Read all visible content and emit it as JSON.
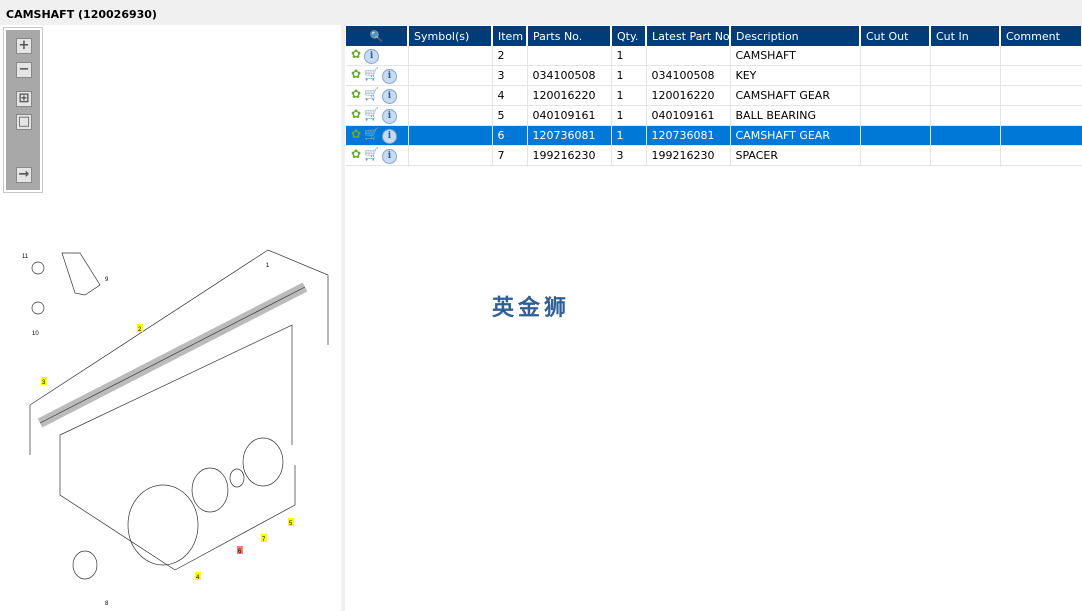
{
  "title": "CAMSHAFT (120026930)",
  "toolbar": {
    "zoom_in": "+",
    "zoom_out": "−"
  },
  "columns": [
    "Symbol(s)",
    "Item",
    "Parts No.",
    "Qty.",
    "Latest Part No.",
    "Description",
    "Cut Out",
    "Cut In",
    "Comment"
  ],
  "rows": [
    {
      "item": "2",
      "parts_no": "",
      "qty": "1",
      "latest": "",
      "description": "CAMSHAFT",
      "cart": false,
      "selected": false
    },
    {
      "item": "3",
      "parts_no": "034100508",
      "qty": "1",
      "latest": "034100508",
      "description": "KEY",
      "cart": true,
      "selected": false
    },
    {
      "item": "4",
      "parts_no": "120016220",
      "qty": "1",
      "latest": "120016220",
      "description": "CAMSHAFT GEAR",
      "cart": true,
      "selected": false
    },
    {
      "item": "5",
      "parts_no": "040109161",
      "qty": "1",
      "latest": "040109161",
      "description": "BALL BEARING",
      "cart": true,
      "selected": false
    },
    {
      "item": "6",
      "parts_no": "120736081",
      "qty": "1",
      "latest": "120736081",
      "description": "CAMSHAFT GEAR",
      "cart": true,
      "selected": true
    },
    {
      "item": "7",
      "parts_no": "199216230",
      "qty": "3",
      "latest": "199216230",
      "description": "SPACER",
      "cart": true,
      "selected": false
    }
  ],
  "watermark": "英金狮",
  "diagram_labels": [
    "1",
    "2",
    "3",
    "4",
    "5",
    "6",
    "7",
    "8",
    "9",
    "10",
    "11"
  ],
  "colors": {
    "header": "#003c78",
    "selected": "#0078d7"
  }
}
